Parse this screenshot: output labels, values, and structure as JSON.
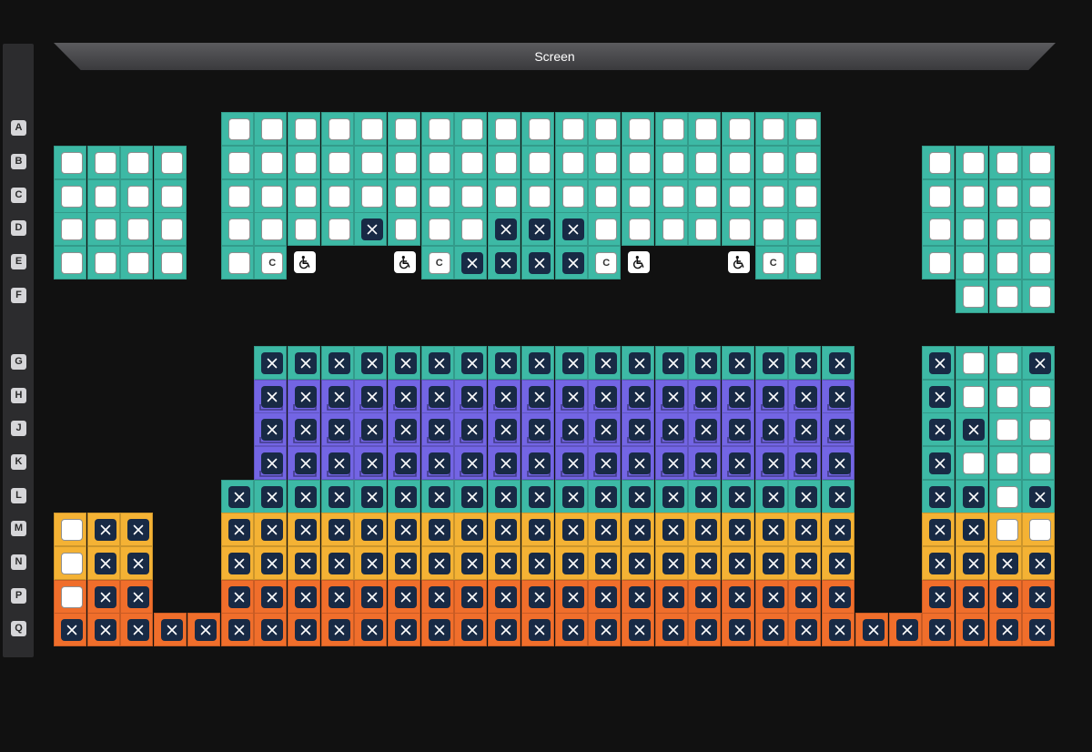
{
  "screen": {
    "label": "Screen"
  },
  "colors": {
    "standard": "#3db9a5",
    "premium": "#7365e4",
    "gold": "#f4b234",
    "front": "#f06e2b",
    "taken_seat": "#182a45",
    "available_seat": "#ffffff"
  },
  "icons": {
    "taken": "x-icon",
    "wheelchair": "wheelchair-icon",
    "recliner": "recliner-icon"
  },
  "rows": [
    {
      "label": "A",
      "sections": [
        {
          "start": 6,
          "zone": "standard",
          "seats": "oooooooooooooooooo"
        }
      ]
    },
    {
      "label": "B",
      "sections": [
        {
          "start": 1,
          "zone": "standard",
          "seats": "oooo"
        },
        {
          "start": 6,
          "zone": "standard",
          "seats": "oooooooooooooooooo"
        },
        {
          "start": 27,
          "zone": "standard",
          "seats": "oooo"
        }
      ]
    },
    {
      "label": "C",
      "sections": [
        {
          "start": 1,
          "zone": "standard",
          "seats": "oooo"
        },
        {
          "start": 6,
          "zone": "standard",
          "seats": "oooooooooooooooooo"
        },
        {
          "start": 27,
          "zone": "standard",
          "seats": "oooo"
        }
      ]
    },
    {
      "label": "D",
      "sections": [
        {
          "start": 1,
          "zone": "standard",
          "seats": "oooo"
        },
        {
          "start": 6,
          "zone": "standard",
          "seats": "ooooxoooxxxooooooo"
        },
        {
          "start": 27,
          "zone": "standard",
          "seats": "oooo"
        }
      ]
    },
    {
      "label": "E",
      "sections": [
        {
          "start": 1,
          "zone": "standard",
          "seats": "oooo"
        },
        {
          "start": 6,
          "zone": "standard",
          "seats": "oc"
        },
        {
          "start": 8,
          "zone": "none",
          "seats": "w"
        },
        {
          "start": 11,
          "zone": "none",
          "seats": "w"
        },
        {
          "start": 12,
          "zone": "standard",
          "seats": "cxxxxc"
        },
        {
          "start": 18,
          "zone": "none",
          "seats": "w"
        },
        {
          "start": 21,
          "zone": "none",
          "seats": "w"
        },
        {
          "start": 22,
          "zone": "standard",
          "seats": "co"
        },
        {
          "start": 27,
          "zone": "standard",
          "seats": "oooo"
        }
      ]
    },
    {
      "label": "F",
      "sections": [
        {
          "start": 28,
          "zone": "standard",
          "seats": "ooo"
        }
      ]
    },
    {
      "label": "G",
      "sections": [
        {
          "start": 7,
          "zone": "standard",
          "seats": "xxxxxxxxxxxxxxxxxx"
        },
        {
          "start": 27,
          "zone": "standard",
          "seats": "xoox"
        }
      ]
    },
    {
      "label": "H",
      "sections": [
        {
          "start": 7,
          "zone": "premium",
          "seats": "xxxxxxxxxxxxxxxxxx"
        },
        {
          "start": 27,
          "zone": "standard",
          "seats": "xooo"
        }
      ]
    },
    {
      "label": "J",
      "sections": [
        {
          "start": 7,
          "zone": "premium",
          "seats": "xxxxxxxxxxxxxxxxxx"
        },
        {
          "start": 27,
          "zone": "standard",
          "seats": "xxoo"
        }
      ]
    },
    {
      "label": "K",
      "sections": [
        {
          "start": 7,
          "zone": "premium",
          "seats": "xxxxxxxxxxxxxxxxxx"
        },
        {
          "start": 27,
          "zone": "standard",
          "seats": "xooo"
        }
      ]
    },
    {
      "label": "L",
      "sections": [
        {
          "start": 6,
          "zone": "standard",
          "seats": "xxxxxxxxxxxxxxxxxxx"
        },
        {
          "start": 27,
          "zone": "standard",
          "seats": "xxox"
        }
      ]
    },
    {
      "label": "M",
      "sections": [
        {
          "start": 1,
          "zone": "gold",
          "seats": "oxx"
        },
        {
          "start": 6,
          "zone": "gold",
          "seats": "xxxxxxxxxxxxxxxxxxx"
        },
        {
          "start": 27,
          "zone": "gold",
          "seats": "xxoo"
        }
      ]
    },
    {
      "label": "N",
      "sections": [
        {
          "start": 1,
          "zone": "gold",
          "seats": "oxx"
        },
        {
          "start": 6,
          "zone": "gold",
          "seats": "xxxxxxxxxxxxxxxxxxx"
        },
        {
          "start": 27,
          "zone": "gold",
          "seats": "xxxx"
        }
      ]
    },
    {
      "label": "P",
      "sections": [
        {
          "start": 1,
          "zone": "front",
          "seats": "oxx"
        },
        {
          "start": 6,
          "zone": "front",
          "seats": "xxxxxxxxxxxxxxxxxxx"
        },
        {
          "start": 27,
          "zone": "front",
          "seats": "xxxx"
        }
      ]
    },
    {
      "label": "Q",
      "sections": [
        {
          "start": 1,
          "zone": "front",
          "seats": "xxxxxxxxxxxxxxxxxxxxxxxxxxxxxx"
        }
      ]
    }
  ]
}
